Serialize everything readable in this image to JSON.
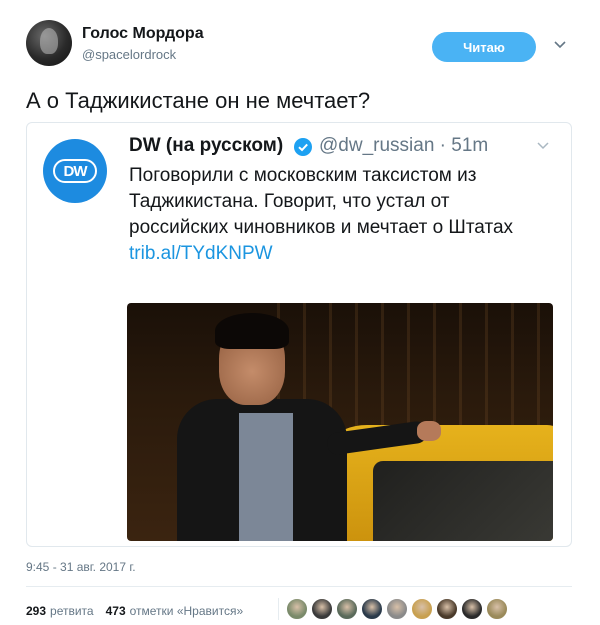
{
  "author": {
    "name": "Голос Мордора",
    "handle": "@spacelordrock"
  },
  "follow_button": "Читаю",
  "tweet_text": "А о Таджикистане он не мечтает?",
  "quoted": {
    "logo_text": "DW",
    "name": "DW (на русском)",
    "handle_time": "@dw_russian · 51m",
    "body": "Поговорили с московским таксистом из Таджикистана. Говорит, что устал от российских чиновников и мечтает о Штатах",
    "link": "trib.al/TYdKNPW"
  },
  "timestamp": "9:45 - 31 авг. 2017 г.",
  "stats": {
    "retweets_count": "293",
    "retweets_label": "ретвита",
    "likes_count": "473",
    "likes_label": "отметки «Нравится»"
  },
  "likers": [
    "#7a8a6a",
    "#3a3a3a",
    "#5a6a5a",
    "#2a3a4a",
    "#8a8a8a",
    "#c8a050",
    "#4a3a2a",
    "#2a2a2a",
    "#9a8a5a"
  ],
  "colors": {
    "accent": "#4ab3f4",
    "link": "#1b95e0",
    "dw_blue": "#1d8be0"
  }
}
